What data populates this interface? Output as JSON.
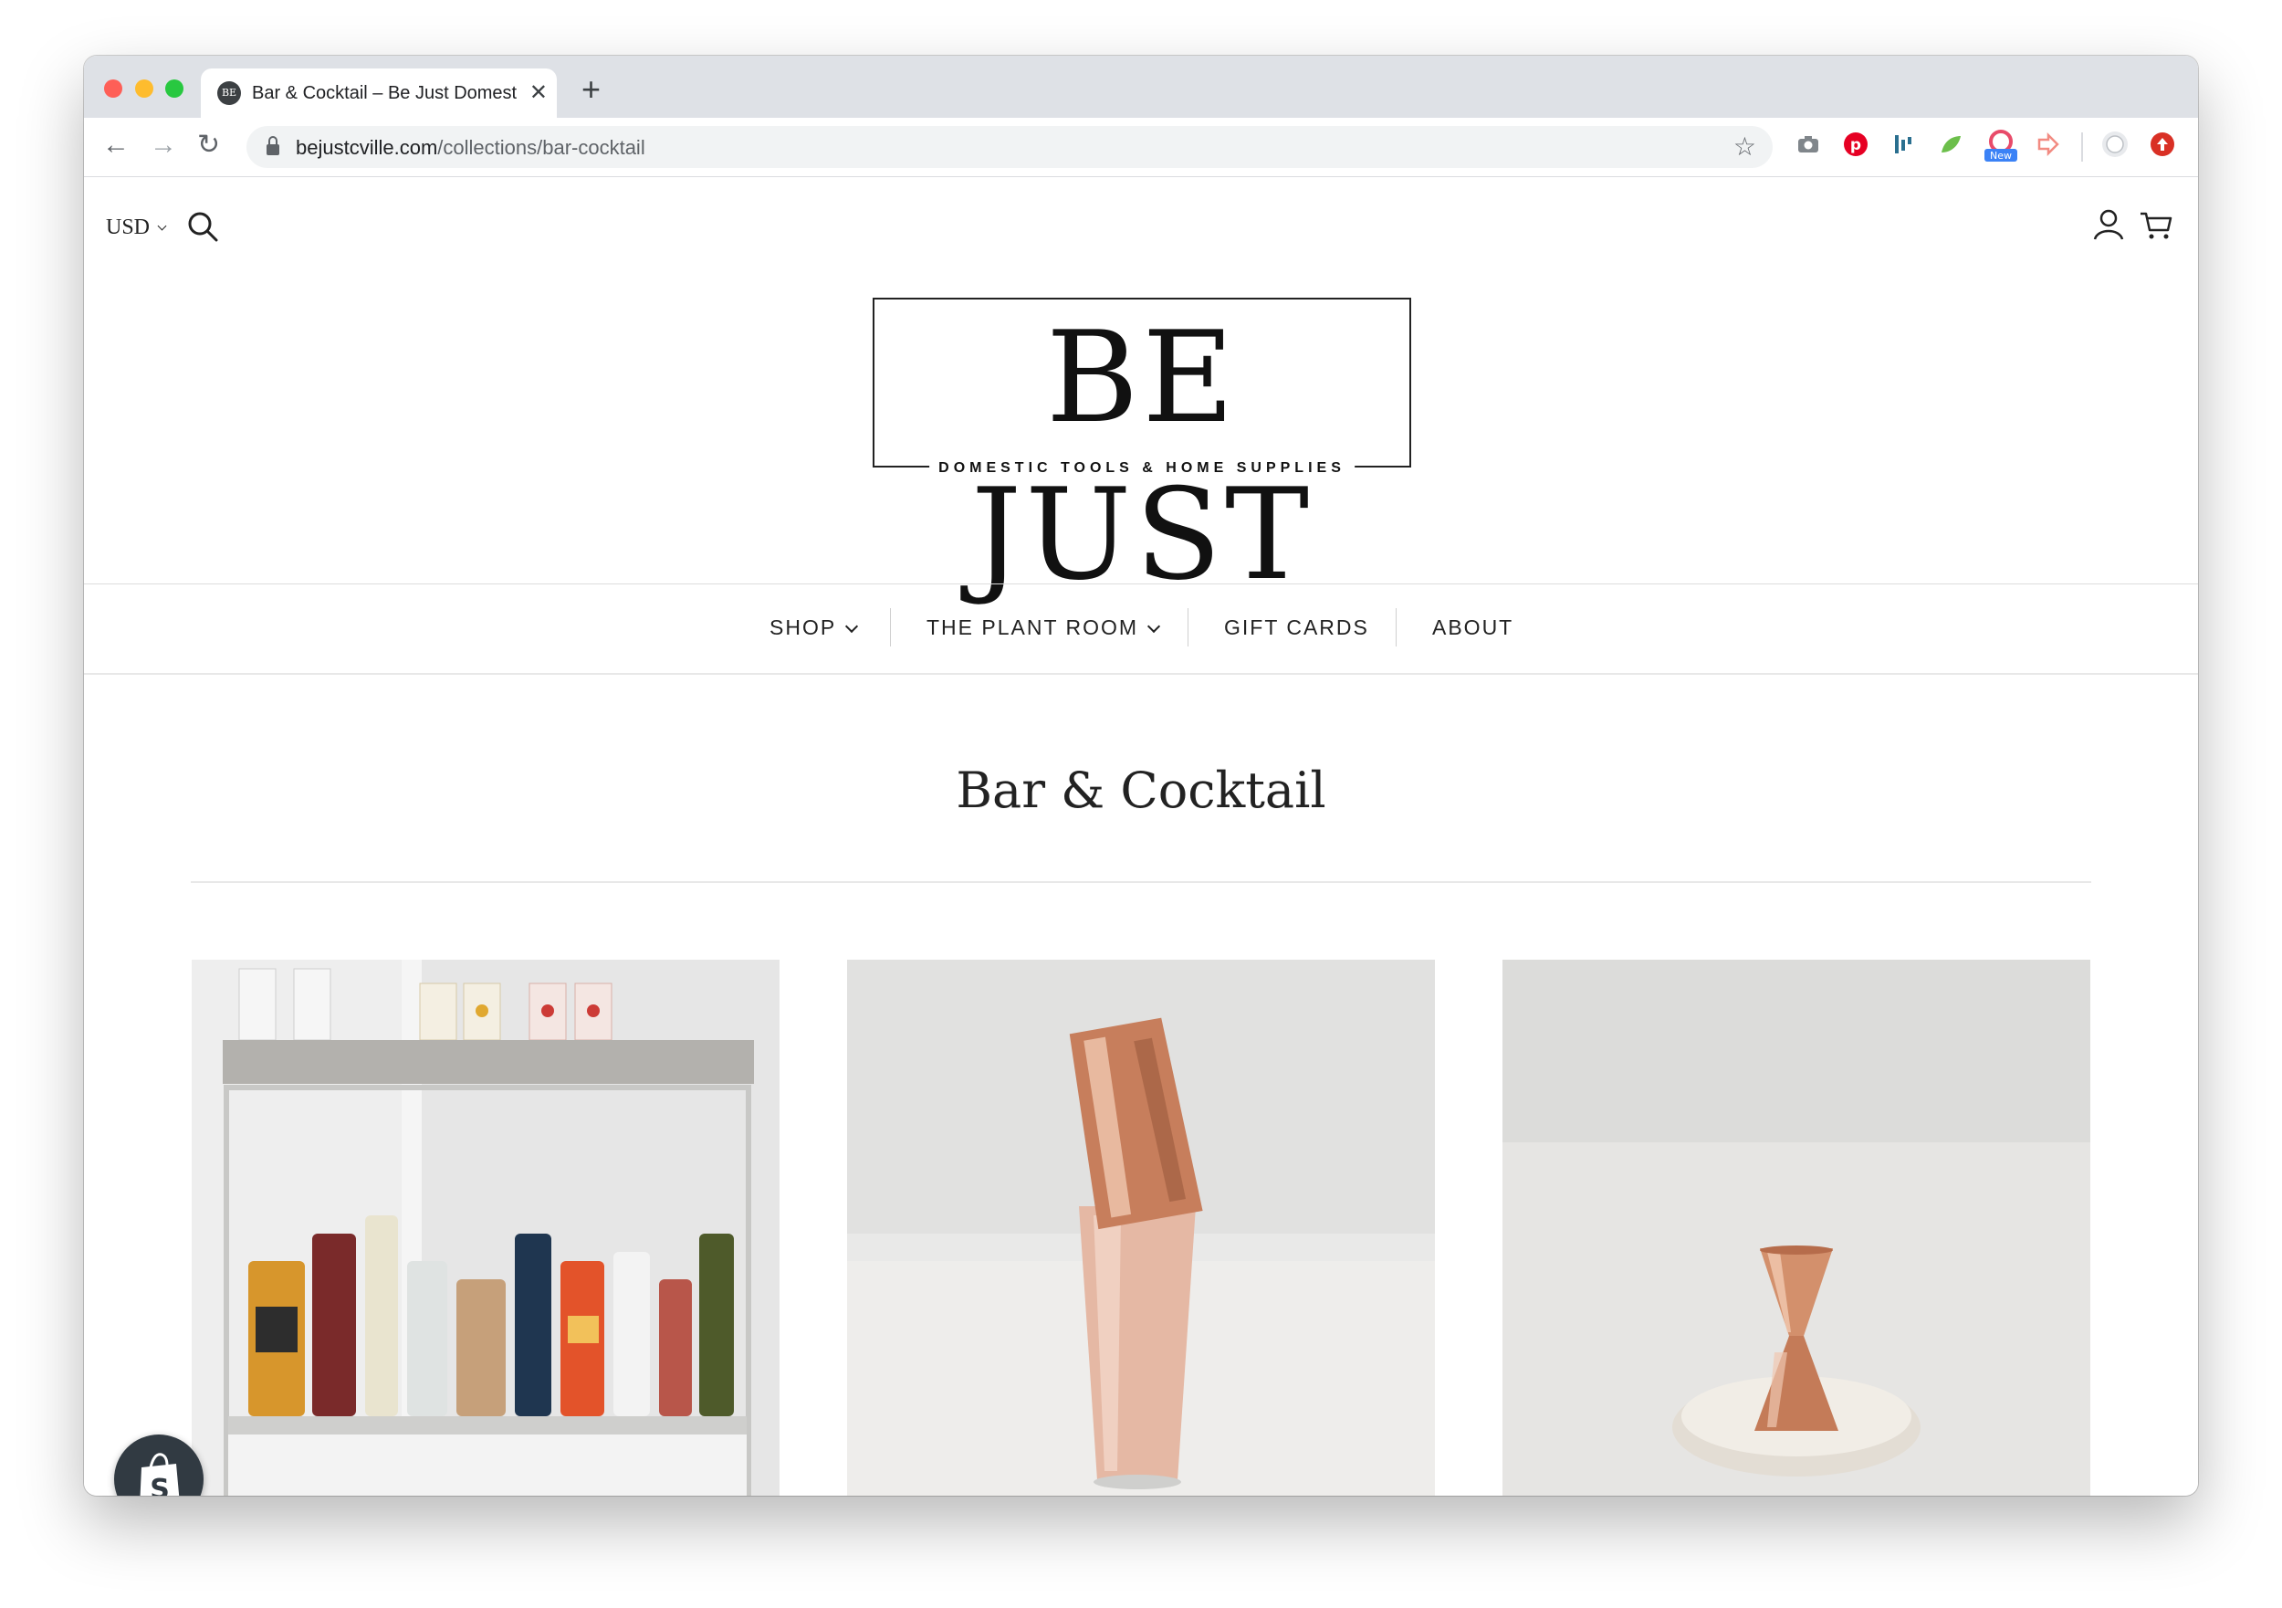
{
  "browser": {
    "tab_title": "Bar & Cocktail – Be Just Domestic Tools & Home Supplies",
    "favicon_text": "BE",
    "url_domain": "bejustcville.com",
    "url_path": "/collections/bar-cocktail",
    "extension_badge": "New"
  },
  "header": {
    "currency": "USD",
    "logo_main": "BE JUST",
    "logo_sub": "DOMESTIC TOOLS & HOME SUPPLIES"
  },
  "nav": {
    "items": [
      {
        "label": "SHOP",
        "dropdown": true
      },
      {
        "label": "THE PLANT ROOM",
        "dropdown": true
      },
      {
        "label": "GIFT CARDS",
        "dropdown": false
      },
      {
        "label": "ABOUT",
        "dropdown": false
      }
    ]
  },
  "collection": {
    "title": "Bar & Cocktail",
    "products": [
      {
        "name": "bar-cart",
        "icon": "bar-cart-image"
      },
      {
        "name": "copper-cocktail-shaker",
        "icon": "shaker-image"
      },
      {
        "name": "copper-jigger",
        "icon": "jigger-image"
      }
    ]
  },
  "colors": {
    "tab_strip": "#dee1e6",
    "text": "#222222",
    "copper": "#d89a80"
  }
}
